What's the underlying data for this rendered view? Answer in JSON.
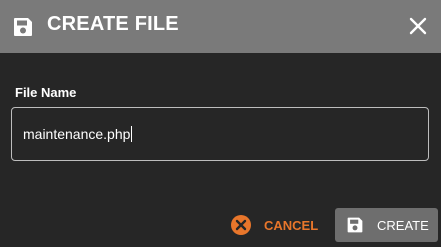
{
  "dialog": {
    "title": "CREATE FILE",
    "title_icon": "floppy-disk-icon",
    "close_icon": "close-icon"
  },
  "form": {
    "field_label": "File Name",
    "field_value": "maintenance.php"
  },
  "actions": {
    "cancel_label": "CANCEL",
    "cancel_icon": "cancel-circle-icon",
    "create_label": "CREATE",
    "create_icon": "floppy-disk-icon"
  },
  "colors": {
    "titlebar": "#7a7a7a",
    "background": "#262626",
    "accent": "#e8762b",
    "create_button": "#6e6e6e"
  }
}
